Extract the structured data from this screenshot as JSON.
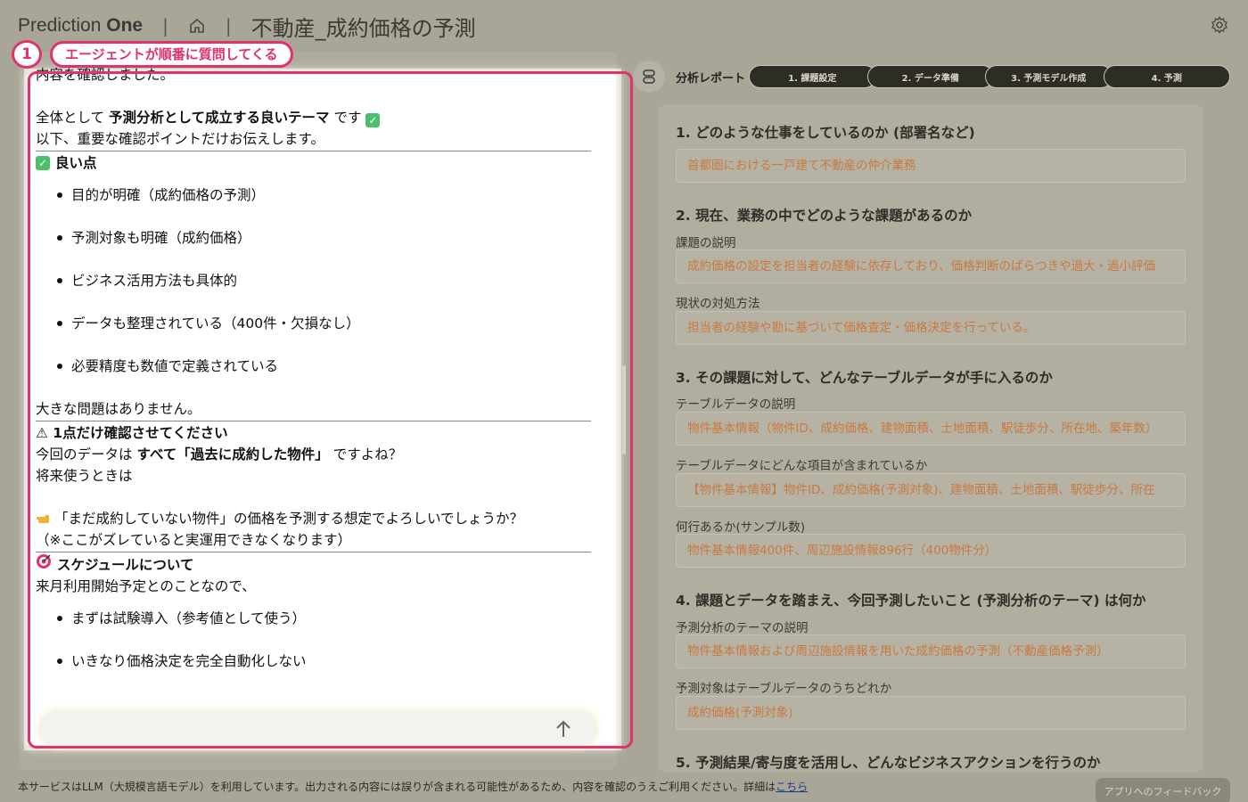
{
  "header": {
    "brand_light": "Prediction",
    "brand_bold": "One",
    "sep1": "|",
    "sep2": "|",
    "title": "不動産_成約価格の予測"
  },
  "annotation": {
    "number": "1",
    "label": "エージェントが順番に質問してくる"
  },
  "chat": {
    "line0": "内容を確認しました。",
    "line1_pre": "全体として",
    "line1_bold": "予測分析として成立する良いテーマ",
    "line1_post": "です",
    "line2": "以下、重要な確認ポイントだけお伝えします。",
    "good_head": "良い点",
    "good_items": [
      "目的が明確（成約価格の予測）",
      "予測対象も明確（成約価格）",
      "ビジネス活用方法も具体的",
      "データも整理されている（400件・欠損なし）",
      "必要精度も数値で定義されている"
    ],
    "no_problem": "大きな問題はありません。",
    "confirm_head": "⚠ 1点だけ確認させてください",
    "confirm_pre": "今回のデータは",
    "confirm_bold": "すべて「過去に成約した物件」",
    "confirm_post": "ですよね？",
    "future": "将来使うときは",
    "question": "「まだ成約していない物件」の価格を予測する想定でよろしいでしょうか？",
    "note": "（※ここがズレていると実運用できなくなります）",
    "schedule_head": "スケジュールについて",
    "schedule_text": "来月利用開始予定とのことなので、",
    "schedule_items": [
      "まずは試験導入（参考値として使う）",
      "いきなり価格決定を完全自動化しない"
    ]
  },
  "report": {
    "label": "分析レポート",
    "steps": [
      "1. 課題設定",
      "2. データ準備",
      "3. 予測モデル作成",
      "4. 予測"
    ],
    "s1_title": "1. どのような仕事をしているのか (部署名など)",
    "s1_value": "首都圏における一戸建て不動産の仲介業務",
    "s2_title": "2. 現在、業務の中でどのような課題があるのか",
    "s2_label1": "課題の説明",
    "s2_value1": "成約価格の設定を担当者の経験に依存しており、価格判断のばらつきや過大・過小評価",
    "s2_label2": "現状の対処方法",
    "s2_value2": "担当者の経験や勘に基づいて価格査定・価格決定を行っている。",
    "s3_title": "3. その課題に対して、どんなテーブルデータが手に入るのか",
    "s3_label1": "テーブルデータの説明",
    "s3_value1": "物件基本情報（物件ID、成約価格、建物面積、土地面積、駅徒歩分、所在地、築年数）",
    "s3_label2": "テーブルデータにどんな項目が含まれているか",
    "s3_value2": "【物件基本情報】物件ID、成約価格(予測対象)、建物面積、土地面積、駅徒歩分、所在",
    "s3_label3": "何行あるか(サンプル数)",
    "s3_value3": "物件基本情報400件、周辺施設情報896行（400物件分）",
    "s4_title": "4. 課題とデータを踏まえ、今回予測したいこと (予測分析のテーマ) は何か",
    "s4_label1": "予測分析のテーマの説明",
    "s4_value1": "物件基本情報および周辺施設情報を用いた成約価格の予測（不動産価格予測）",
    "s4_label2": "予測対象はテーブルデータのうちどれか",
    "s4_value2": "成約価格(予測対象)",
    "s5_title": "5. 予測結果/寄与度を活用し、どんなビジネスアクションを行うのか"
  },
  "footer": {
    "text": "本サービスはLLM（大規模言語モデル）を利用しています。出力される内容には誤りが含まれる可能性があるため、内容を確認のうえご利用ください。詳細は",
    "link": "こちら",
    "feedback": "アプリへのフィードバック"
  },
  "colors": {
    "accent": "#e0336e",
    "overlay": "#a9a698",
    "field_text": "#c9793f"
  }
}
